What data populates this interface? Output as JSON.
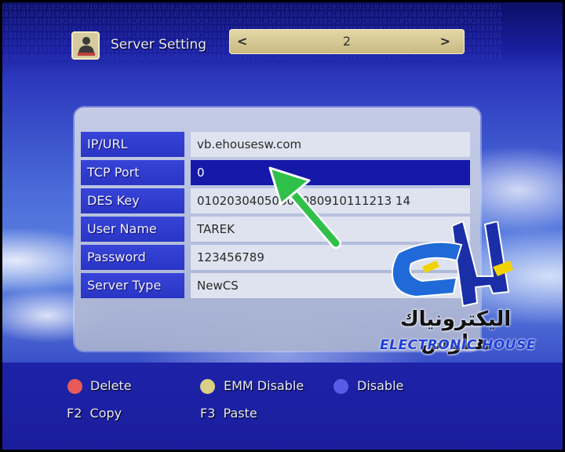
{
  "header": {
    "title": "Server Setting",
    "icon": "server-user-icon",
    "selector": {
      "value": "2",
      "left_arrow": "<",
      "right_arrow": ">"
    }
  },
  "settings": [
    {
      "label": "IP/URL",
      "value": "vb.ehousesw.com"
    },
    {
      "label": "TCP Port",
      "value": "0",
      "active": true
    },
    {
      "label": "DES Key",
      "value": "01020304050607080910111213 14"
    },
    {
      "label": "User Name",
      "value": "TAREK"
    },
    {
      "label": "Password",
      "value": "123456789"
    },
    {
      "label": "Server Type",
      "value": "NewCS"
    }
  ],
  "legend": {
    "red": {
      "label": "Delete",
      "color": "#e85a5a"
    },
    "yellow": {
      "label": "EMM Disable",
      "color": "#d9cf86"
    },
    "blue": {
      "label": "Disable",
      "color": "#5a5ae8"
    },
    "f2": "F2  Copy",
    "f3": "F3  Paste"
  },
  "watermark": {
    "arabic": "اليكترونياك هـاوس",
    "english": "ELECTRONIC HOUSE"
  },
  "colors": {
    "label_bg": "#2f3ccf",
    "active_row": "#1518a8",
    "annotation_arrow": "#2fc04a"
  }
}
